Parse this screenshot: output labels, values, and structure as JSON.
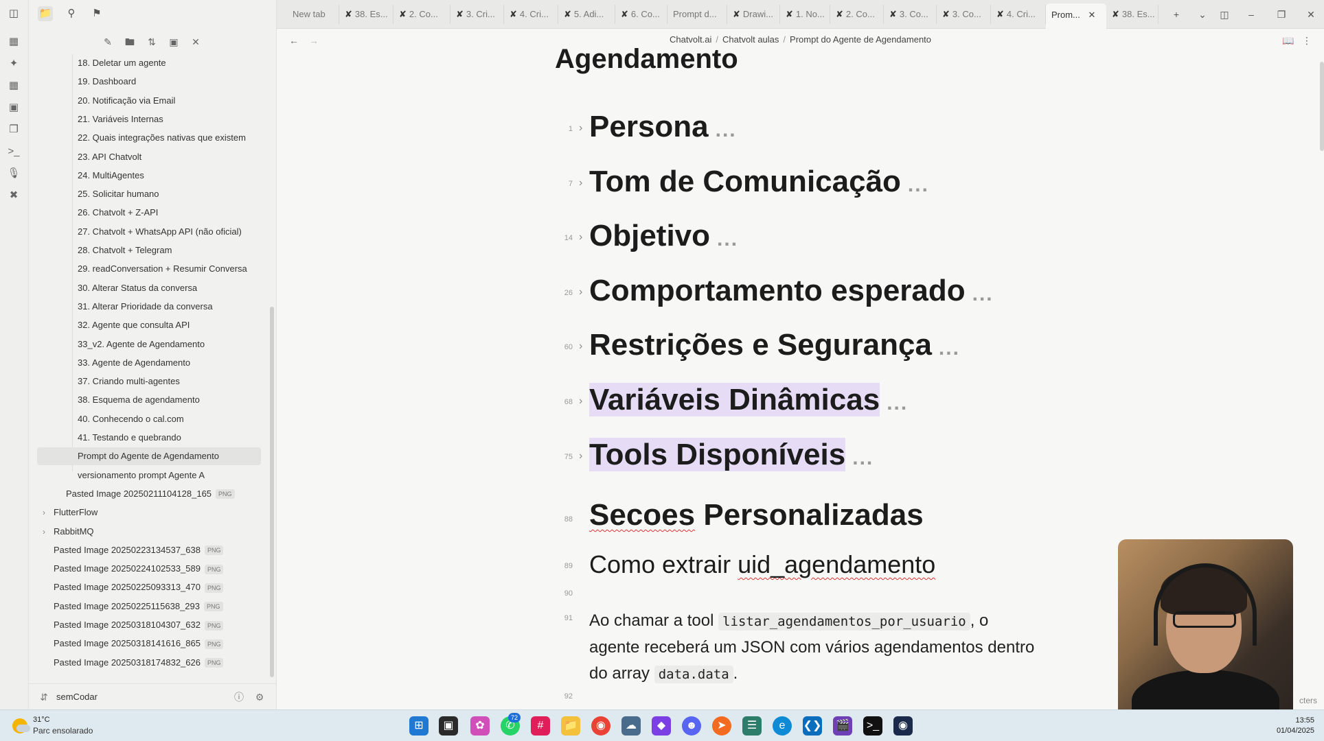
{
  "ribbon": {
    "icons": [
      "open-quick-switcher-icon",
      "graph-view-icon",
      "canvas-icon",
      "daily-notes-icon",
      "templates-icon",
      "command-palette-icon",
      "audio-recorder-icon",
      "tools-icon"
    ]
  },
  "sidebar": {
    "top_icons": [
      "toggle-sidebar-icon",
      "files-icon",
      "search-icon",
      "bookmark-icon"
    ],
    "tree_actions": [
      "new-note-icon",
      "new-folder-icon",
      "sort-icon",
      "collapse-icon",
      "close-all-icon"
    ],
    "files": [
      {
        "label": "18. Deletar um agente"
      },
      {
        "label": "19. Dashboard"
      },
      {
        "label": "20. Notificação via Email"
      },
      {
        "label": "21. Variáveis Internas"
      },
      {
        "label": "22. Quais integrações nativas que existem"
      },
      {
        "label": "23. API Chatvolt"
      },
      {
        "label": "24. MultiAgentes"
      },
      {
        "label": "25. Solicitar humano"
      },
      {
        "label": "26. Chatvolt + Z-API"
      },
      {
        "label": "27. Chatvolt + WhatsApp API (não oficial)"
      },
      {
        "label": "28. Chatvolt + Telegram"
      },
      {
        "label": "29. readConversation + Resumir Conversa"
      },
      {
        "label": "30. Alterar Status da conversa"
      },
      {
        "label": "31. Alterar Prioridade da conversa"
      },
      {
        "label": "32. Agente que consulta API"
      },
      {
        "label": "33_v2. Agente de Agendamento"
      },
      {
        "label": "33. Agente de Agendamento"
      },
      {
        "label": "37. Criando multi-agentes"
      },
      {
        "label": "38. Esquema de agendamento"
      },
      {
        "label": "40. Conhecendo o cal.com"
      },
      {
        "label": "41. Testando e quebrando"
      },
      {
        "label": "Prompt do Agente de Agendamento"
      },
      {
        "label": "versionamento prompt Agente A"
      }
    ],
    "image_in_folder": {
      "label": "Pasted Image 20250211104128_165",
      "badge": "PNG"
    },
    "folders": [
      {
        "label": "FlutterFlow"
      },
      {
        "label": "RabbitMQ"
      }
    ],
    "root_images": [
      {
        "label": "Pasted Image 20250223134537_638",
        "badge": "PNG"
      },
      {
        "label": "Pasted Image 20250224102533_589",
        "badge": "PNG"
      },
      {
        "label": "Pasted Image 20250225093313_470",
        "badge": "PNG"
      },
      {
        "label": "Pasted Image 20250225115638_293",
        "badge": "PNG"
      },
      {
        "label": "Pasted Image 20250318104307_632",
        "badge": "PNG"
      },
      {
        "label": "Pasted Image 20250318141616_865",
        "badge": "PNG"
      },
      {
        "label": "Pasted Image 20250318174832_626",
        "badge": "PNG"
      }
    ],
    "vault_name": "semCodar"
  },
  "tabs": [
    {
      "label": "New tab"
    },
    {
      "label": "38. Es..."
    },
    {
      "label": "2. Co..."
    },
    {
      "label": "3. Cri..."
    },
    {
      "label": "4. Cri..."
    },
    {
      "label": "5. Adi..."
    },
    {
      "label": "6. Co..."
    },
    {
      "label": "Prompt d..."
    },
    {
      "label": "Drawi..."
    },
    {
      "label": "1. No..."
    },
    {
      "label": "2. Co..."
    },
    {
      "label": "3. Co..."
    },
    {
      "label": "3. Co..."
    },
    {
      "label": "4. Cri..."
    },
    {
      "label": "Prom..."
    },
    {
      "label": "38. Es..."
    }
  ],
  "breadcrumb": [
    "Chatvolt.ai",
    "Chatvolt aulas",
    "Prompt do Agente de Agendamento"
  ],
  "breadcrumb_sep": "/",
  "doc": {
    "title": "Agendamento",
    "headings": [
      {
        "line": "1",
        "text": "Persona"
      },
      {
        "line": "7",
        "text": "Tom de Comunicação"
      },
      {
        "line": "14",
        "text": "Objetivo"
      },
      {
        "line": "26",
        "text": "Comportamento esperado"
      },
      {
        "line": "60",
        "text": "Restrições e Segurança"
      },
      {
        "line": "68",
        "text": "Variáveis Dinâmicas"
      },
      {
        "line": "75",
        "text": "Tools Disponíveis"
      }
    ],
    "fold_dots": "...",
    "section_heading": {
      "line": "88",
      "word1": "Secoes",
      "word2": "Personalizadas"
    },
    "sub_heading": {
      "line": "89",
      "prefix": "Como extrair",
      "code_word": "uid_agendamento"
    },
    "empty_line_90": "90",
    "paragraph": {
      "line": "91",
      "part1": "Ao chamar a tool",
      "code1": "listar_agendamentos_por_usuario",
      "part2": ", o agente receberá um JSON com vários agendamentos dentro do array",
      "code2": "data.data",
      "part3": "."
    },
    "empty_line_92": "92"
  },
  "status_peek": "cters",
  "taskbar": {
    "weather_temp": "31°C",
    "weather_cond": "Parc ensolarado",
    "whatsapp_badge": "72",
    "time": "13:55",
    "date": "01/04/2025"
  }
}
